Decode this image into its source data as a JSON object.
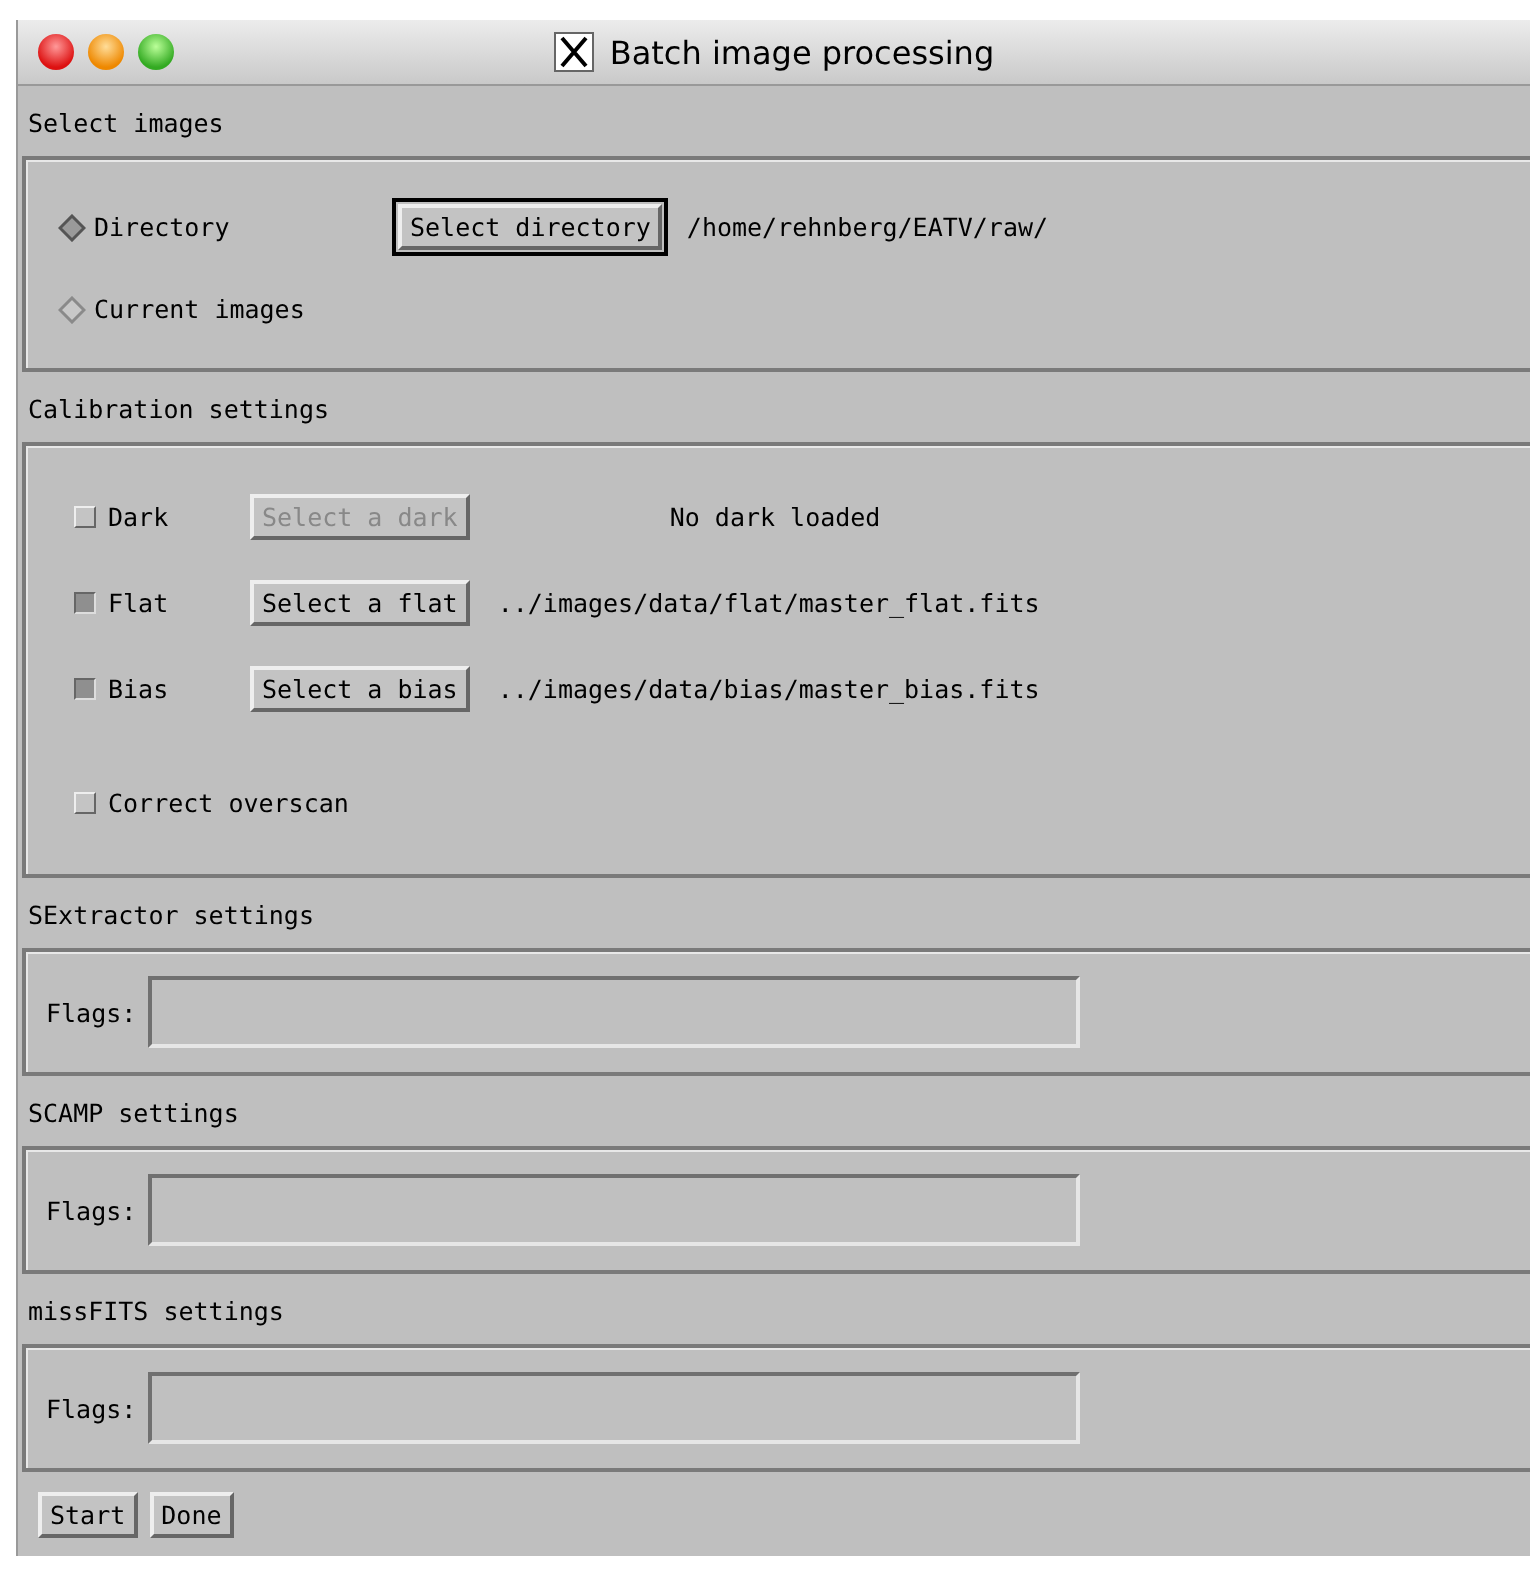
{
  "window": {
    "title": "Batch image processing"
  },
  "sections": [
    {
      "kind": "images",
      "title": "Select images",
      "options": [
        {
          "label": "Directory",
          "selected": true,
          "button": "Select directory",
          "path": "/home/rehnberg/EATV/raw/"
        },
        {
          "label": "Current images",
          "selected": false
        }
      ]
    },
    {
      "kind": "calibration",
      "title": "Calibration settings",
      "rows": [
        {
          "label": "Dark",
          "checked": false,
          "button": "Select a dark",
          "disabled": true,
          "status": "No dark loaded"
        },
        {
          "label": "Flat",
          "checked": true,
          "button": "Select a flat",
          "disabled": false,
          "status": "../images/data/flat/master_flat.fits"
        },
        {
          "label": "Bias",
          "checked": true,
          "button": "Select a bias",
          "disabled": false,
          "status": "../images/data/bias/master_bias.fits"
        }
      ],
      "overscan": {
        "label": "Correct overscan",
        "checked": false
      }
    },
    {
      "kind": "flags",
      "title": "SExtractor settings",
      "label": "Flags:"
    },
    {
      "kind": "flags",
      "title": "SCAMP settings",
      "label": "Flags:"
    },
    {
      "kind": "flags",
      "title": "missFITS settings",
      "label": "Flags:"
    }
  ],
  "buttons": [
    "Start",
    "Done"
  ]
}
